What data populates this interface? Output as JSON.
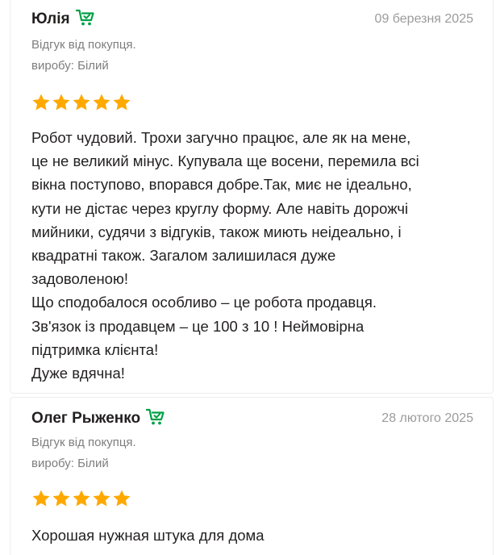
{
  "reviews": [
    {
      "author": "Юлія",
      "date": "09 березня 2025",
      "buyer_label": "Відгук від покупця.",
      "product_label": "виробу: Білий",
      "rating": 5,
      "text_lines": [
        "Робот чудовий. Трохи загучно працює, але як на мене,",
        "це не великий мінус. Купувала ще восени, перемила всі",
        "вікна поступово, впорався добре.Так, миє не ідеально,",
        "кути не дістає через круглу форму. Але навіть дорожчі",
        "мийники, судячи з відгуків, також миють неідеально, і",
        "квадратні також. Загалом залишилася дуже",
        "задоволеною!",
        "Що сподобалося особливо – це робота продавця.",
        "Зв'язок із продавцем – це 100 з 10 ! Неймовірна",
        "підтримка клієнта!",
        "Дуже вдячна!"
      ]
    },
    {
      "author": "Олег Рыженко",
      "date": "28 лютого 2025",
      "buyer_label": "Відгук від покупця.",
      "product_label": "виробу: Білий",
      "rating": 5,
      "text_lines": [
        "Хорошая нужная штука для дома"
      ]
    }
  ],
  "icons": {
    "buyer_badge": "cart-check-icon",
    "star": "star-icon"
  },
  "colors": {
    "star": "#ffa900",
    "buyer_badge": "#00a046",
    "date": "#9b9b9b",
    "meta": "#7e7e7e",
    "text": "#221f1f"
  }
}
